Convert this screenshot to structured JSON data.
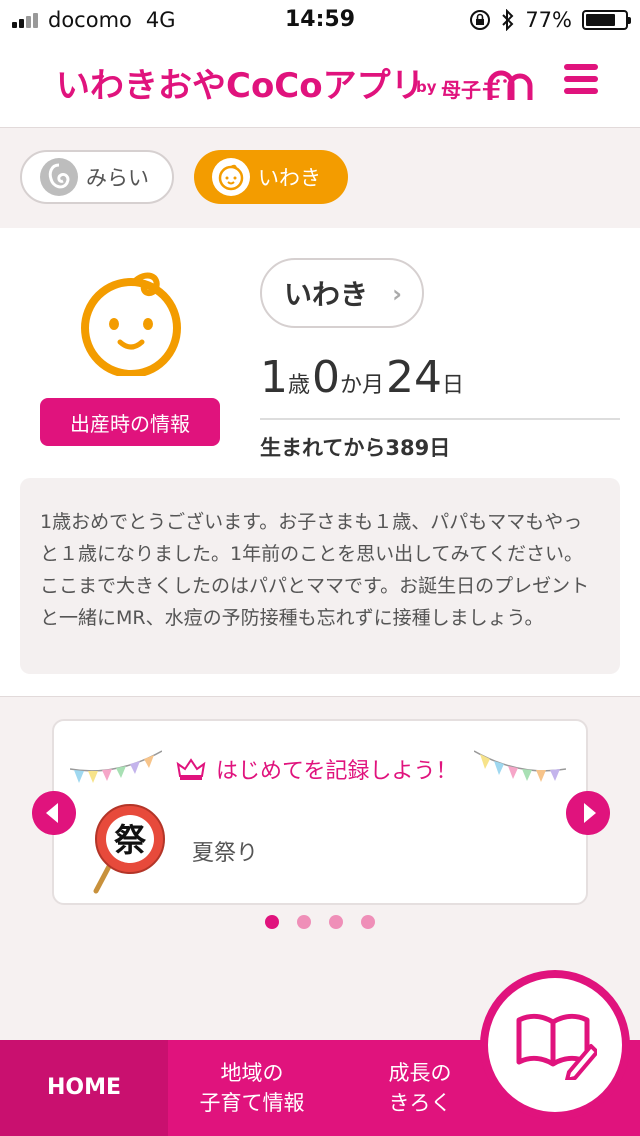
{
  "status_bar": {
    "carrier": "docomo",
    "network": "4G",
    "time": "14:59",
    "battery": "77%",
    "battery_level": 0.77
  },
  "header": {
    "title": "いわきおやCoCoアプリ",
    "by": "by",
    "brand": "母子モ"
  },
  "child_tabs": [
    {
      "label": "みらい",
      "selected": false
    },
    {
      "label": "いわき",
      "selected": true
    }
  ],
  "profile": {
    "name": "いわき",
    "birth_info_label": "出産時の情報",
    "age": {
      "years": "1",
      "years_unit": "歳",
      "months": "0",
      "months_unit": "か月",
      "days": "24",
      "days_unit": "日"
    },
    "days_since_birth": "生まれてから389日",
    "message": "1歳おめでとうございます。お子さまも１歳、パパもママもやっと１歳になりました。1年前のことを思い出してみてください。ここまで大きくしたのはパパとママです。お誕生日のプレゼントと一緒にMR、水痘の予防接種も忘れずに接種しましょう。"
  },
  "carousel": {
    "heading": "はじめてを記録しよう！",
    "item_label": "夏祭り",
    "fan_text": "祭",
    "page_count": 4,
    "active_index": 0
  },
  "bottom_nav": {
    "home": "HOME",
    "local_line1": "地域の",
    "local_line2": "子育て情報",
    "growth_line1": "成長の",
    "growth_line2": "きろく"
  },
  "colors": {
    "brand_pink": "#e0137d",
    "orange": "#f39c00"
  }
}
